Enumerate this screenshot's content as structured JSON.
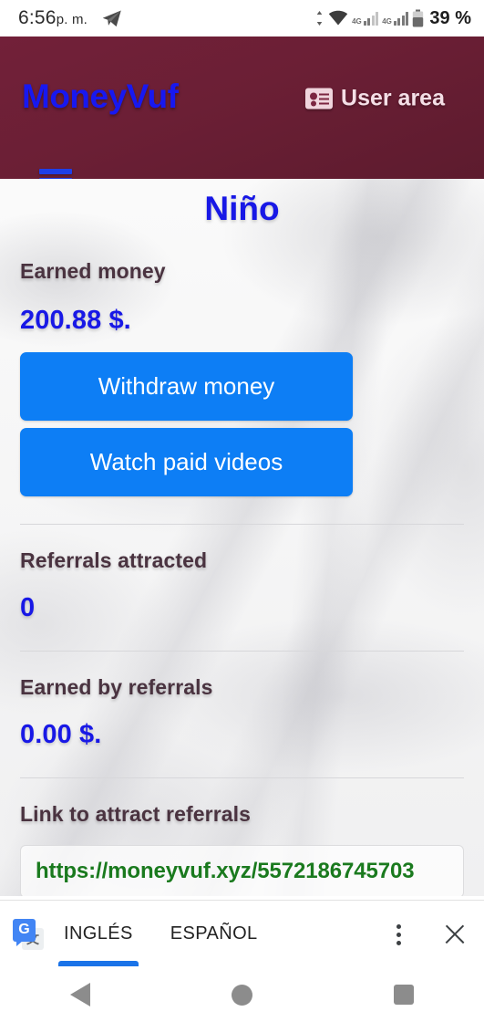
{
  "status_bar": {
    "time": "6:56",
    "ampm": "p. m.",
    "notification_icon": "telegram-icon",
    "network_label_1": "4G",
    "network_label_2": "4G",
    "battery_percent": "39 %"
  },
  "app_header": {
    "brand": "MoneyVuf",
    "user_area_label": "User area",
    "user_area_icon": "id-card-icon",
    "menu_icon": "hamburger-menu-icon",
    "background_color": "#6b1f35",
    "brand_color": "#1818f0"
  },
  "main": {
    "title": "Niño",
    "stats": [
      {
        "label": "Earned money",
        "value": "200.88 $."
      },
      {
        "label": "Referrals attracted",
        "value": "0"
      },
      {
        "label": "Earned by referrals",
        "value": "0.00 $."
      }
    ],
    "buttons": {
      "withdraw": "Withdraw money",
      "watch_videos": "Watch paid videos",
      "color": "#0d7ef5"
    },
    "referral_link": {
      "label": "Link to attract referrals",
      "value": "https://moneyvuf.xyz/5572186745703",
      "color": "#1a7a1e"
    },
    "value_color": "#1818e6",
    "label_color": "#4a3340"
  },
  "translate_bar": {
    "app_icon": "google-translate-icon",
    "source_language": "INGLÉS",
    "target_language": "ESPAÑOL",
    "active_language": "INGLÉS",
    "more_options_icon": "kebab-menu-icon",
    "close_icon": "close-icon",
    "accent_color": "#1a73e8"
  },
  "nav_bar": {
    "back_icon": "back-triangle-icon",
    "home_icon": "home-circle-icon",
    "recents_icon": "recents-square-icon"
  }
}
